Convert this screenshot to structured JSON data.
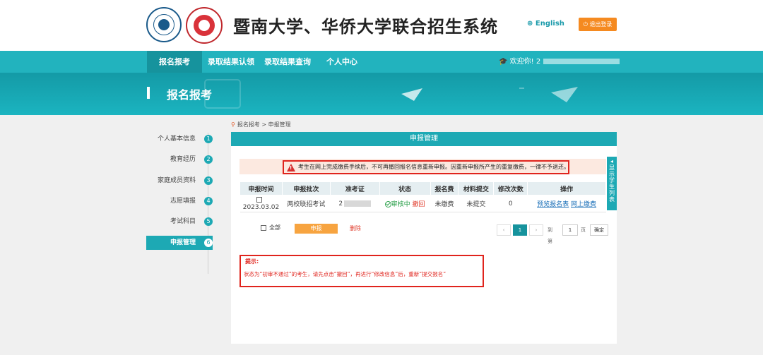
{
  "header": {
    "title": "暨南大学、华侨大学联合招生系统",
    "language": "English",
    "logout": "退出登录"
  },
  "nav": {
    "items": [
      "报名报考",
      "录取结果认领",
      "录取结果查询",
      "个人中心"
    ],
    "welcome": "欢迎你! 2"
  },
  "banner": {
    "title": "报名报考"
  },
  "sidebar": {
    "items": [
      {
        "label": "个人基本信息",
        "num": "1"
      },
      {
        "label": "教育经历",
        "num": "2"
      },
      {
        "label": "家庭成员资料",
        "num": "3"
      },
      {
        "label": "志愿填报",
        "num": "4"
      },
      {
        "label": "考试科目",
        "num": "5"
      },
      {
        "label": "申报管理",
        "num": "6"
      }
    ]
  },
  "breadcrumb": "报名报考 > 申报管理",
  "panel": {
    "title": "申报管理",
    "warning": "考生在网上完成缴费手续后，不可再撤回报名信息重新申报。因重新申报所产生的重复缴费，一律不予退还。",
    "columns": [
      "申报时间",
      "申报批次",
      "准考证",
      "状态",
      "报名费",
      "材料提交",
      "修改次数",
      "操作"
    ],
    "row": {
      "date": "2023.03.02",
      "batch": "两校联招考试",
      "ticket": "2",
      "status": "审核中",
      "revoke": "撤回",
      "fee": "未缴费",
      "material": "未提交",
      "edits": "0",
      "preview": "预览报名表",
      "pay": "网上缴费"
    },
    "select_all": "全部",
    "apply": "申报",
    "delete": "删除",
    "pager": {
      "prev": "‹",
      "page": "1",
      "next": "›",
      "goto": "到第",
      "input": "1",
      "unit": "页",
      "confirm": "确定"
    },
    "tip_title": "提示:",
    "tip_text": "状态为“初审不通过”的考生，请先点击“撤回”，再进行“修改信息”后，重新“提交报名”"
  },
  "side_tab": "显示学生列表"
}
